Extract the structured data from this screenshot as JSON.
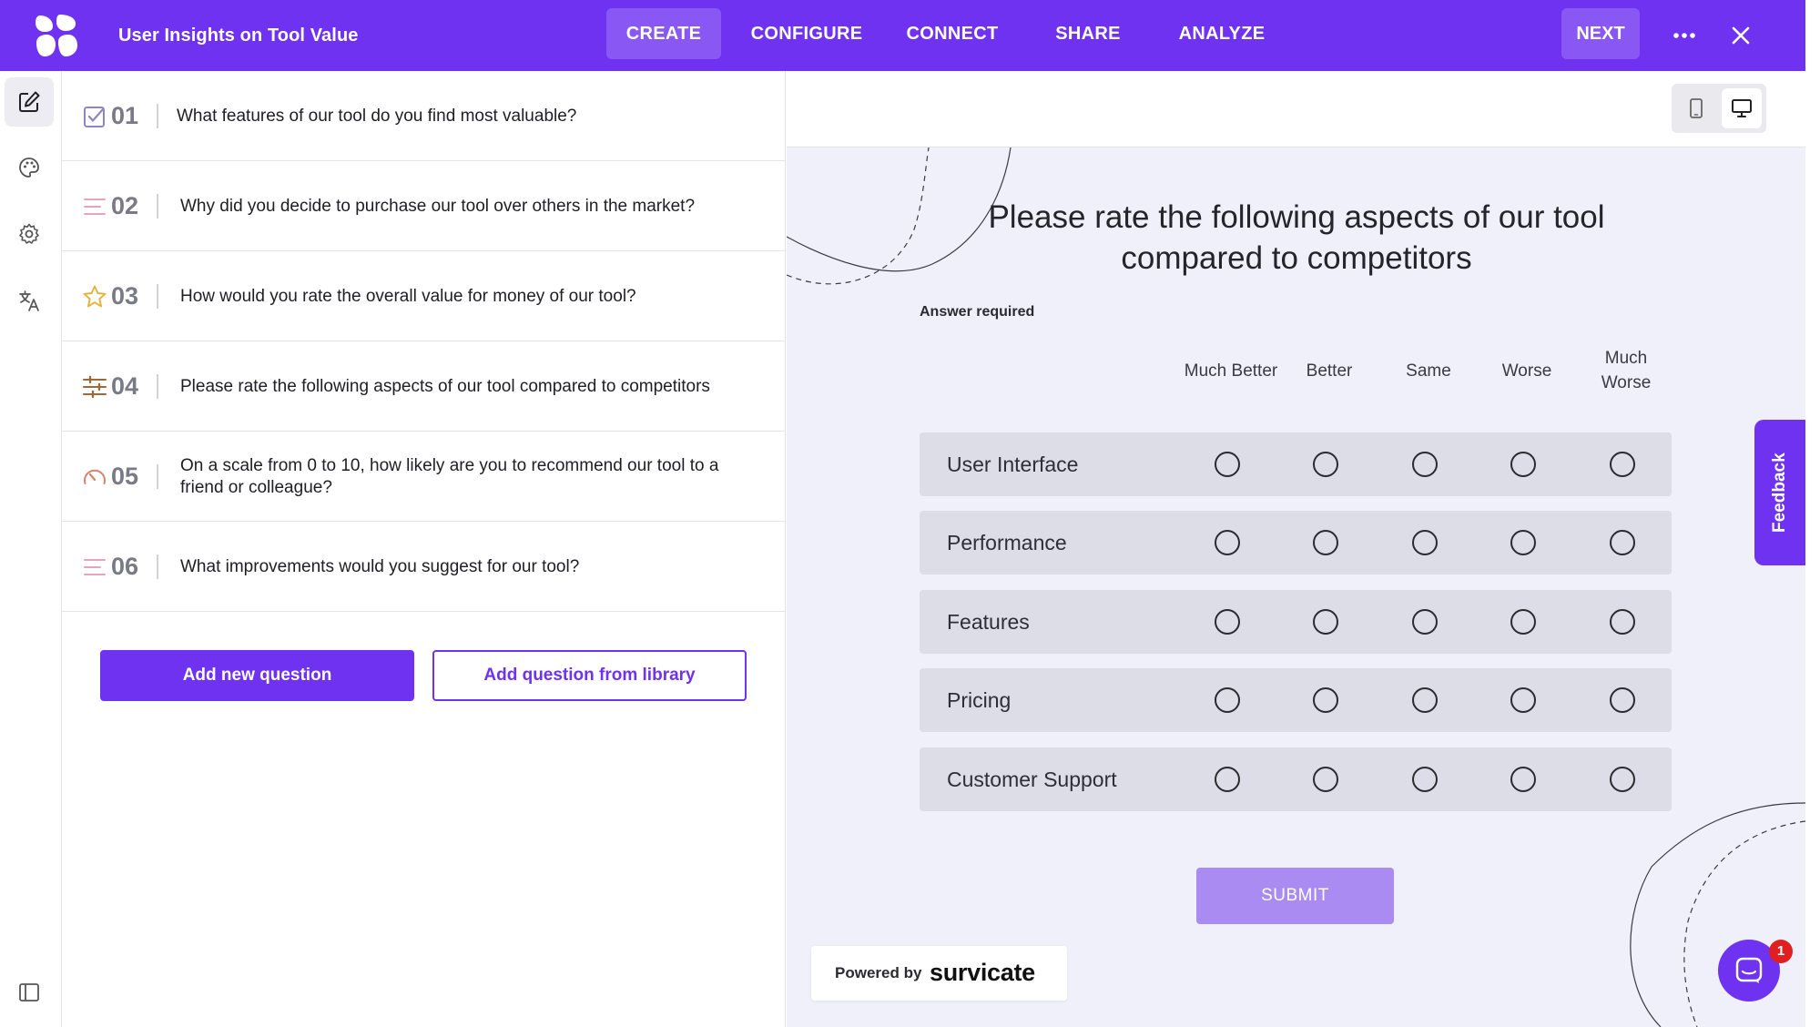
{
  "app": {
    "survey_title": "User Insights on Tool Value",
    "logo_icon": "survicate-logo-icon",
    "colors": {
      "brand": "#6e32f0",
      "nav_active": "#8957f4",
      "preview_bg": "#eff0f9",
      "row_bg": "#dddde7",
      "submit_bg": "#a98bf2"
    }
  },
  "nav": {
    "tabs": [
      {
        "label": "CREATE",
        "active": true
      },
      {
        "label": "CONFIGURE",
        "active": false
      },
      {
        "label": "CONNECT",
        "active": false
      },
      {
        "label": "SHARE",
        "active": false
      },
      {
        "label": "ANALYZE",
        "active": false
      }
    ],
    "next_label": "NEXT",
    "more_icon": "more-horizontal-icon",
    "close_icon": "close-icon"
  },
  "rail": {
    "items": [
      {
        "icon": "edit-icon",
        "active": true
      },
      {
        "icon": "palette-icon",
        "active": false
      },
      {
        "icon": "gear-icon",
        "active": false
      },
      {
        "icon": "translate-icon",
        "active": false
      }
    ],
    "bottom_icon": "sidebar-toggle-icon"
  },
  "questions": [
    {
      "number": "01",
      "type_icon": "checkbox-icon",
      "text": "What features of our tool do you find most valuable?"
    },
    {
      "number": "02",
      "type_icon": "text-lines-icon",
      "text": "Why did you decide to purchase our tool over others in the market?"
    },
    {
      "number": "03",
      "type_icon": "star-icon",
      "text": "How would you rate the overall value for money of our tool?"
    },
    {
      "number": "04",
      "type_icon": "matrix-sliders-icon",
      "text": "Please rate the following aspects of our tool compared to competitors"
    },
    {
      "number": "05",
      "type_icon": "gauge-icon",
      "text": "On a scale from 0 to 10, how likely are you to recommend our tool to a friend or colleague?"
    },
    {
      "number": "06",
      "type_icon": "text-lines-icon",
      "text": "What improvements would you suggest for our tool?"
    }
  ],
  "actions": {
    "add_new": "Add new question",
    "add_library": "Add question from library"
  },
  "preview": {
    "device_icons": [
      "mobile-icon",
      "desktop-icon"
    ],
    "active_device": "desktop",
    "title": "Please rate the following aspects of our tool compared to competitors",
    "answer_required": "Answer required",
    "columns": [
      "Much Better",
      "Better",
      "Same",
      "Worse",
      "Much Worse"
    ],
    "rows": [
      "User Interface",
      "Performance",
      "Features",
      "Pricing",
      "Customer Support"
    ],
    "submit_label": "SUBMIT",
    "powered_by": "Powered by",
    "brand": "survicate"
  },
  "widgets": {
    "feedback_label": "Feedback",
    "chat_icon": "chat-icon",
    "chat_badge": "1"
  }
}
